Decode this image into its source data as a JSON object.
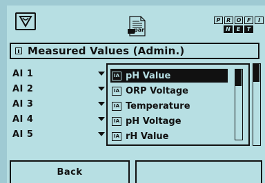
{
  "header": {
    "doc_icon_label": "par",
    "brand_top": [
      "P",
      "R",
      "O",
      "F",
      "I"
    ],
    "brand_bottom": [
      "N",
      "E",
      "T"
    ]
  },
  "title": {
    "text": "Measured Values (Admin.)"
  },
  "rows": [
    {
      "label": "AI 1"
    },
    {
      "label": "AI 2"
    },
    {
      "label": "AI 3"
    },
    {
      "label": "AI 4"
    },
    {
      "label": "AI 5"
    }
  ],
  "dropdown": {
    "options": [
      {
        "tag": "IA",
        "label": "pH Value",
        "selected": true
      },
      {
        "tag": "IA",
        "label": "ORP Voltage",
        "selected": false
      },
      {
        "tag": "IA",
        "label": "Temperature",
        "selected": false
      },
      {
        "tag": "IA",
        "label": "pH Voltage",
        "selected": false
      },
      {
        "tag": "IA",
        "label": "rH Value",
        "selected": false
      }
    ]
  },
  "softkeys": {
    "left": "Back",
    "right": ""
  },
  "colors": {
    "lcd_background": "#b7dfe3",
    "outer_background": "#9fcad3",
    "foreground": "#111111"
  }
}
